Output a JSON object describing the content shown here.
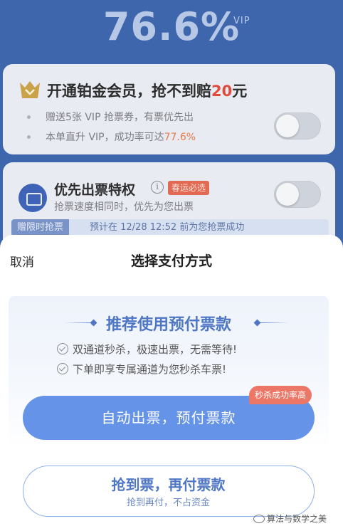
{
  "header": {
    "success_rate": "76.6%",
    "vip_label": "VIP"
  },
  "platinum_card": {
    "title_prefix": "开通铂金会员，抢不到赔",
    "title_amount": "20",
    "title_suffix": "元",
    "bullets": [
      {
        "text": "赠送5张 VIP 抢票券，有票优先出"
      },
      {
        "text_prefix": "本单直升 VIP，成功率可达",
        "highlight": "77.6%"
      }
    ],
    "toggle_on": false
  },
  "priority_card": {
    "title": "优先出票特权",
    "info_glyph": "i",
    "tag": "春运必选",
    "subtitle": "抢票速度相同时，优先为您出票",
    "limit_tag": "赠限时抢票",
    "limit_text": "预计在 12/28 12:52 前为您抢票成功",
    "toggle_on": false
  },
  "sheet": {
    "cancel_label": "取消",
    "title": "选择支付方式",
    "recommend_title": "推荐使用预付票款",
    "features": [
      "双通道秒杀，极速出票，无需等待!",
      "下单即享专属通道为您秒杀车票!"
    ],
    "badge": "秒杀成功率高",
    "primary_button": "自动出票，预付票款",
    "secondary_button_main": "抢到票，再付票款",
    "secondary_button_sub": "抢到再付，不占资金"
  },
  "watermark": "算法与数学之美",
  "colors": {
    "accent": "#6493e8",
    "brand_blue": "#4e76c4",
    "highlight_red": "#e24b3b",
    "badge": "#ec7767"
  }
}
